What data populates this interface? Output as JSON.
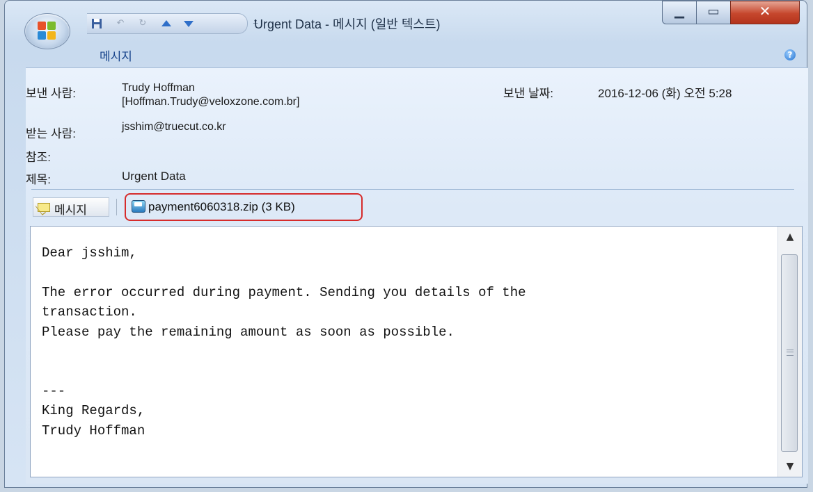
{
  "window": {
    "title": "Urgent Data - 메시지 (일반 텍스트)",
    "controls": {
      "minimize_icon": "minimize-icon",
      "maximize_icon": "maximize-icon",
      "close_icon": "close-icon"
    }
  },
  "quick_access": {
    "icons": [
      "save-icon",
      "undo-icon",
      "redo-icon",
      "previous-item-icon",
      "next-item-icon",
      "customize-dropdown-icon"
    ]
  },
  "ribbon": {
    "tab_label": "메시지",
    "help_icon": "help-icon"
  },
  "header": {
    "from_label": "보낸 사람:",
    "from_name": "Trudy Hoffman",
    "from_address": "[Hoffman.Trudy@veloxzone.com.br]",
    "sent_label": "보낸 날짜:",
    "sent_value": "2016-12-06 (화) 오전 5:28",
    "to_label": "받는 사람:",
    "to_value": "jsshim@truecut.co.kr",
    "cc_label": "참조:",
    "cc_value": "",
    "subject_label": "제목:",
    "subject_value": "Urgent Data"
  },
  "attachments_bar": {
    "message_tab": "메시지",
    "attachment": "payment6060318.zip (3 KB)",
    "highlight_color": "#d62b2b"
  },
  "body": {
    "text": "Dear jsshim,\n\nThe error occurred during payment. Sending you details of the\ntransaction.\nPlease pay the remaining amount as soon as possible.\n\n\n---\nKing Regards,\nTrudy Hoffman"
  },
  "colors": {
    "accent": "#15428b",
    "close_button": "#c6472d"
  }
}
